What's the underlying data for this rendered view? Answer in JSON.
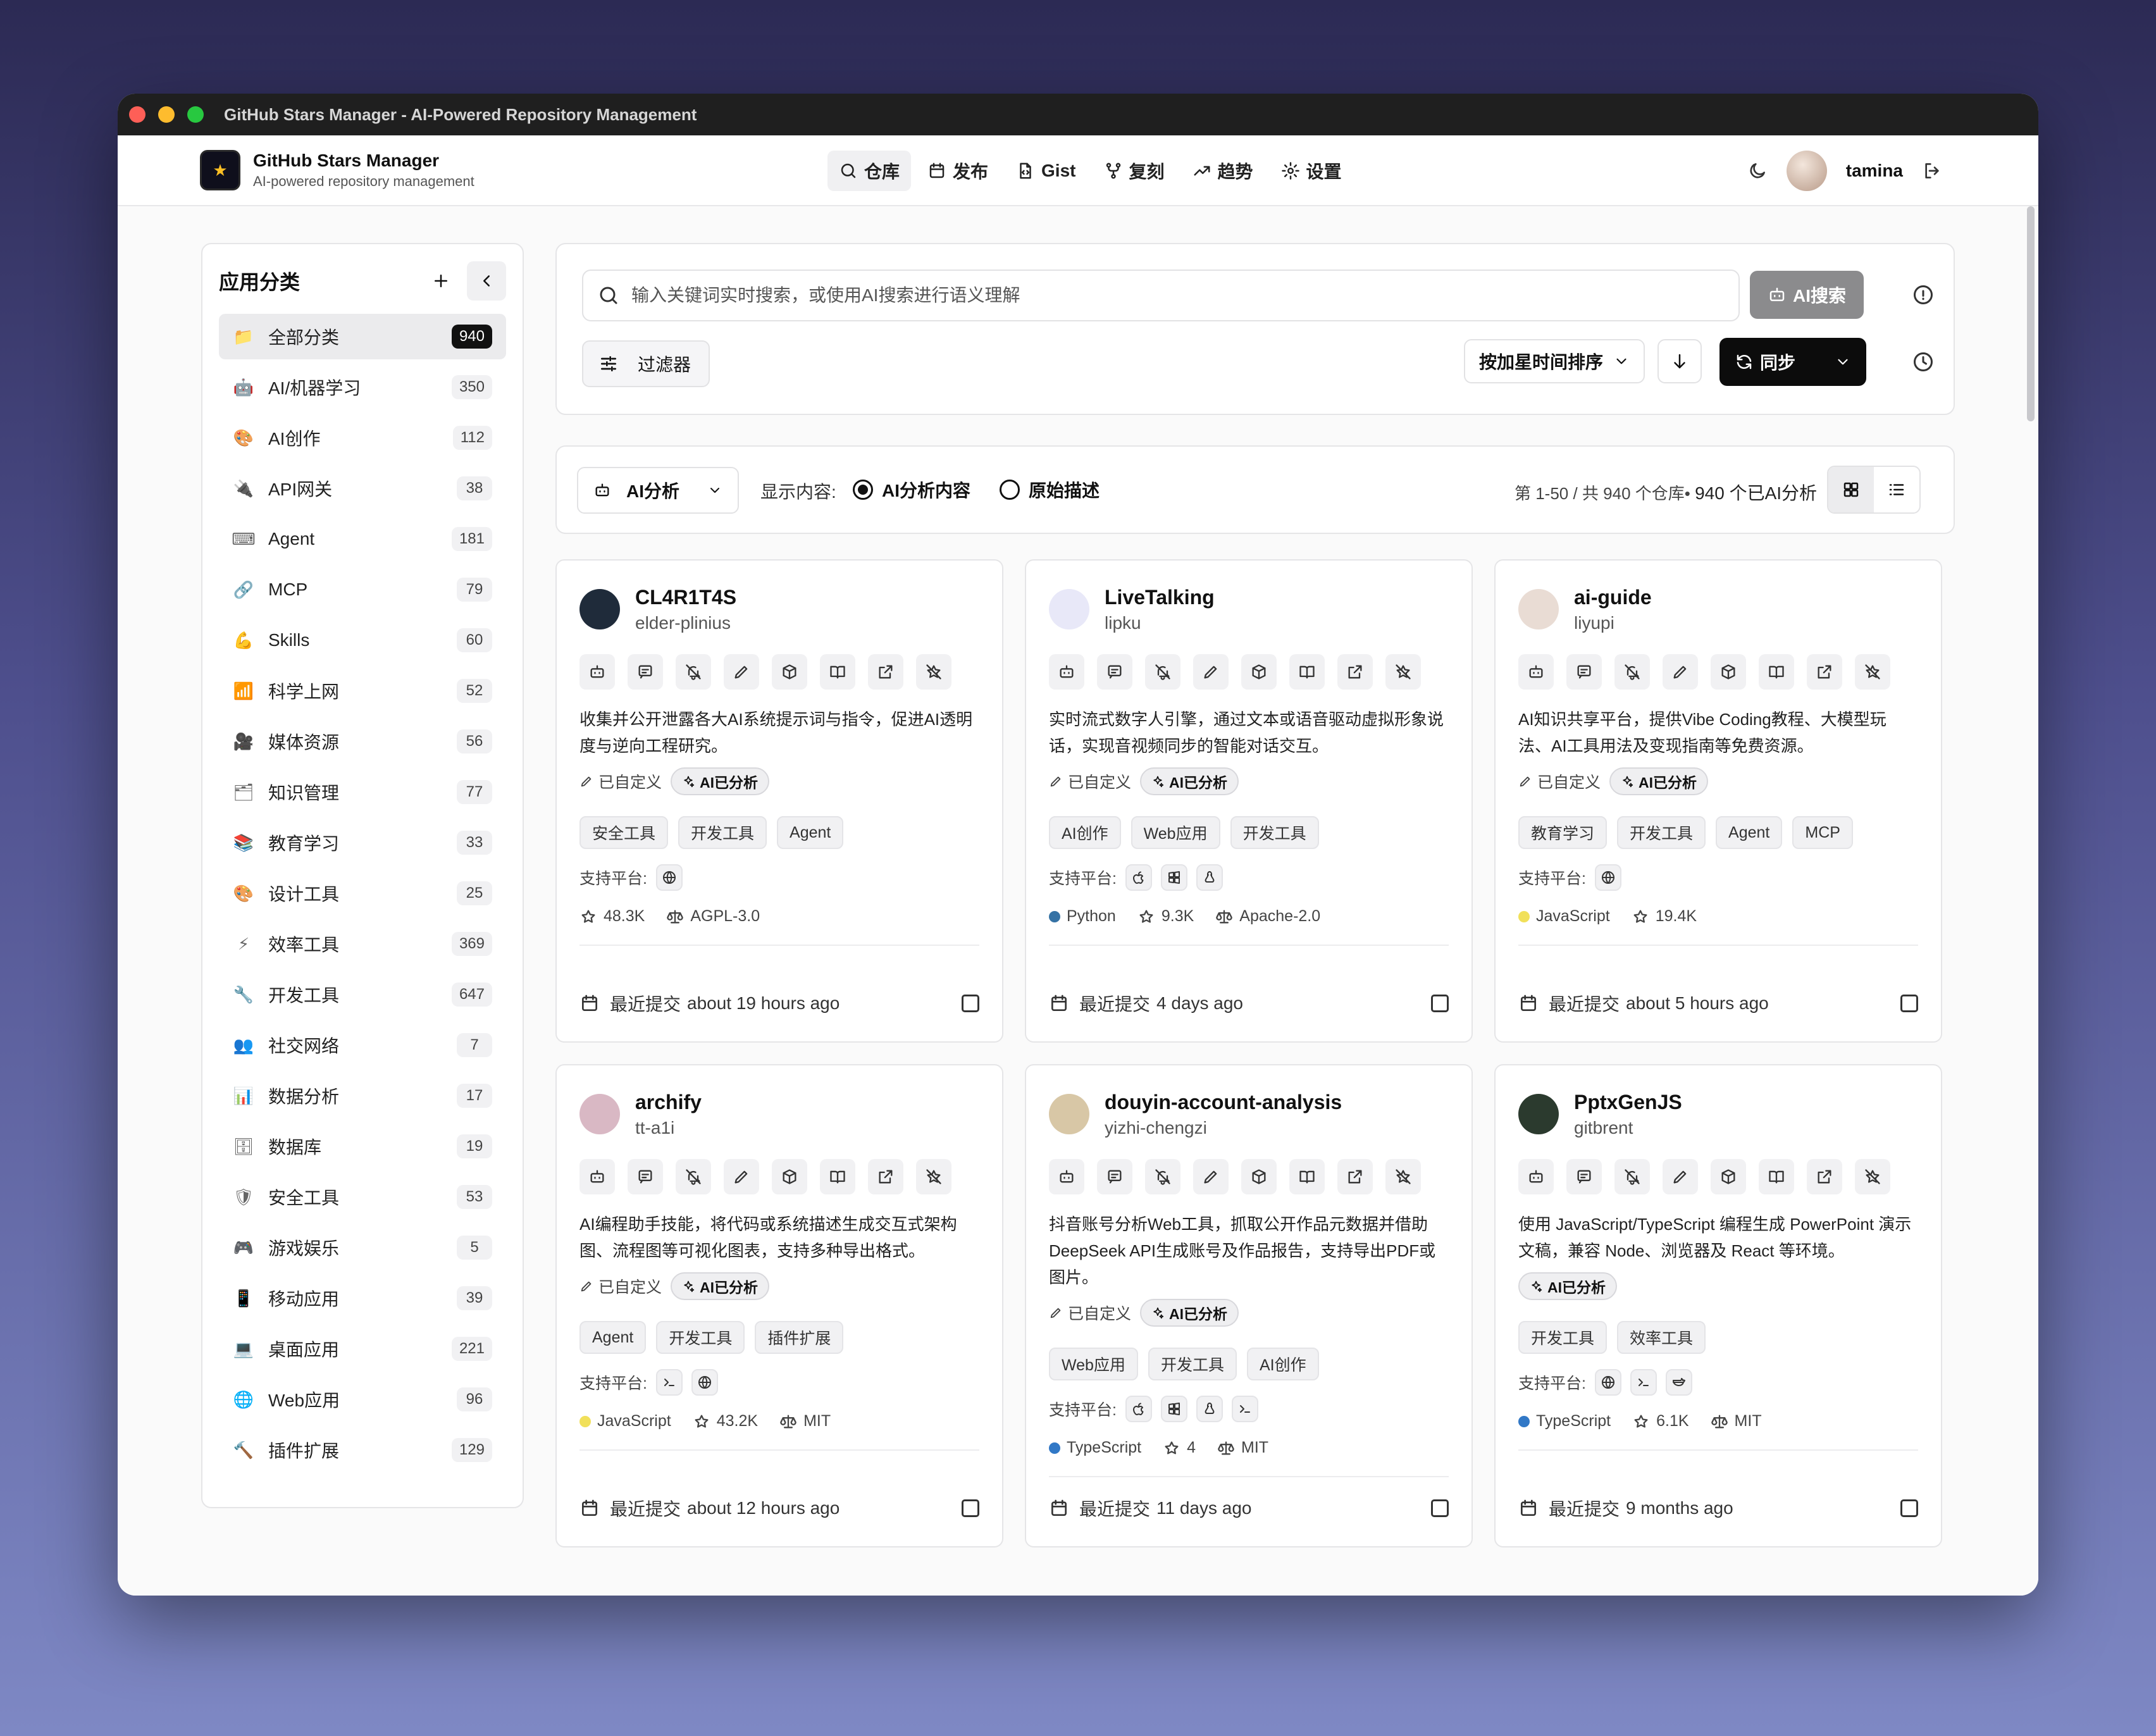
{
  "window": {
    "title": "GitHub Stars Manager - AI-Powered Repository Management"
  },
  "header": {
    "brand_name": "GitHub Stars Manager",
    "brand_sub": "AI-powered repository management",
    "nav": [
      {
        "label": "仓库",
        "icon": "search-icon"
      },
      {
        "label": "发布",
        "icon": "calendar-icon"
      },
      {
        "label": "Gist",
        "icon": "file-code-icon"
      },
      {
        "label": "复刻",
        "icon": "git-fork-icon"
      },
      {
        "label": "趋势",
        "icon": "trending-icon"
      },
      {
        "label": "设置",
        "icon": "gear-icon"
      }
    ],
    "username": "tamina"
  },
  "sidebar": {
    "title": "应用分类",
    "items": [
      {
        "emoji": "📁",
        "label": "全部分类",
        "count": "940"
      },
      {
        "emoji": "🤖",
        "label": "AI/机器学习",
        "count": "350"
      },
      {
        "emoji": "🎨",
        "label": "AI创作",
        "count": "112"
      },
      {
        "emoji": "🔌",
        "label": "API网关",
        "count": "38"
      },
      {
        "emoji": "⌨",
        "label": "Agent",
        "count": "181"
      },
      {
        "emoji": "🔗",
        "label": "MCP",
        "count": "79"
      },
      {
        "emoji": "💪",
        "label": "Skills",
        "count": "60"
      },
      {
        "emoji": "📶",
        "label": "科学上网",
        "count": "52"
      },
      {
        "emoji": "🎥",
        "label": "媒体资源",
        "count": "56"
      },
      {
        "emoji": "🗂",
        "label": "知识管理",
        "count": "77"
      },
      {
        "emoji": "📚",
        "label": "教育学习",
        "count": "33"
      },
      {
        "emoji": "🎨",
        "label": "设计工具",
        "count": "25"
      },
      {
        "emoji": "⚡",
        "label": "效率工具",
        "count": "369"
      },
      {
        "emoji": "🔧",
        "label": "开发工具",
        "count": "647"
      },
      {
        "emoji": "👥",
        "label": "社交网络",
        "count": "7"
      },
      {
        "emoji": "📊",
        "label": "数据分析",
        "count": "17"
      },
      {
        "emoji": "🗄",
        "label": "数据库",
        "count": "19"
      },
      {
        "emoji": "🛡",
        "label": "安全工具",
        "count": "53"
      },
      {
        "emoji": "🎮",
        "label": "游戏娱乐",
        "count": "5"
      },
      {
        "emoji": "📱",
        "label": "移动应用",
        "count": "39"
      },
      {
        "emoji": "💻",
        "label": "桌面应用",
        "count": "221"
      },
      {
        "emoji": "🌐",
        "label": "Web应用",
        "count": "96"
      },
      {
        "emoji": "🔨",
        "label": "插件扩展",
        "count": "129"
      }
    ]
  },
  "search": {
    "placeholder": "输入关键词实时搜索，或使用AI搜索进行语义理解",
    "ai_button": "AI搜索",
    "filter_label": "过滤器",
    "sort_label": "按加星时间排序",
    "sync_label": "同步"
  },
  "view": {
    "mode_label": "AI分析",
    "show_label": "显示内容:",
    "radio_ai": "AI分析内容",
    "radio_raw": "原始描述",
    "stats_prefix": "第 1-50 / 共 940 个仓库•",
    "stats_count": "940 个已AI分析"
  },
  "card_labels": {
    "custom": "已自定义",
    "ai_done": "AI已分析",
    "platform": "支持平台:",
    "commit_prefix": "最近提交"
  },
  "repos": [
    {
      "name": "CL4R1T4S",
      "owner": "elder-plinius",
      "desc": "收集并公开泄露各大AI系统提示词与指令，促进AI透明度与逆向工程研究。",
      "custom": true,
      "tags": [
        "安全工具",
        "开发工具",
        "Agent"
      ],
      "platforms": [
        "globe-icon"
      ],
      "lang": "",
      "lang_color": "",
      "stars": "48.3K",
      "license": "AGPL-3.0",
      "commit": "about 19 hours ago",
      "avatar_color": "#1f2b3a"
    },
    {
      "name": "LiveTalking",
      "owner": "lipku",
      "desc": "实时流式数字人引擎，通过文本或语音驱动虚拟形象说话，实现音视频同步的智能对话交互。",
      "custom": true,
      "tags": [
        "AI创作",
        "Web应用",
        "开发工具"
      ],
      "platforms": [
        "apple-icon",
        "windows-icon",
        "linux-icon"
      ],
      "lang": "Python",
      "lang_color": "#3572A5",
      "stars": "9.3K",
      "license": "Apache-2.0",
      "commit": "4 days ago",
      "avatar_color": "#e8e8f8"
    },
    {
      "name": "ai-guide",
      "owner": "liyupi",
      "desc": "AI知识共享平台，提供Vibe Coding教程、大模型玩法、AI工具用法及变现指南等免费资源。",
      "custom": true,
      "tags": [
        "教育学习",
        "开发工具",
        "Agent",
        "MCP"
      ],
      "platforms": [
        "globe-icon"
      ],
      "lang": "JavaScript",
      "lang_color": "#f1e05a",
      "stars": "19.4K",
      "license": "",
      "commit": "about 5 hours ago",
      "avatar_color": "#e9dcd4"
    },
    {
      "name": "archify",
      "owner": "tt-a1i",
      "desc": "AI编程助手技能，将代码或系统描述生成交互式架构图、流程图等可视化图表，支持多种导出格式。",
      "custom": true,
      "tags": [
        "Agent",
        "开发工具",
        "插件扩展"
      ],
      "platforms": [
        "terminal-icon",
        "globe-icon"
      ],
      "lang": "JavaScript",
      "lang_color": "#f1e05a",
      "stars": "43.2K",
      "license": "MIT",
      "commit": "about 12 hours ago",
      "avatar_color": "#d9b8c4"
    },
    {
      "name": "douyin-account-analysis",
      "owner": "yizhi-chengzi",
      "desc": "抖音账号分析Web工具，抓取公开作品元数据并借助DeepSeek API生成账号及作品报告，支持导出PDF或图片。",
      "custom": true,
      "tags": [
        "Web应用",
        "开发工具",
        "AI创作"
      ],
      "platforms": [
        "apple-icon",
        "windows-icon",
        "linux-icon",
        "terminal-icon"
      ],
      "lang": "TypeScript",
      "lang_color": "#3178c6",
      "stars": "4",
      "license": "MIT",
      "commit": "11 days ago",
      "avatar_color": "#d8c7a6"
    },
    {
      "name": "PptxGenJS",
      "owner": "gitbrent",
      "desc": "使用 JavaScript/TypeScript 编程生成 PowerPoint 演示文稿，兼容 Node、浏览器及 React 等环境。",
      "custom": false,
      "tags": [
        "开发工具",
        "效率工具"
      ],
      "platforms": [
        "globe-icon",
        "terminal-icon",
        "docker-icon"
      ],
      "lang": "TypeScript",
      "lang_color": "#3178c6",
      "stars": "6.1K",
      "license": "MIT",
      "commit": "9 months ago",
      "avatar_color": "#2b3a2e"
    }
  ]
}
